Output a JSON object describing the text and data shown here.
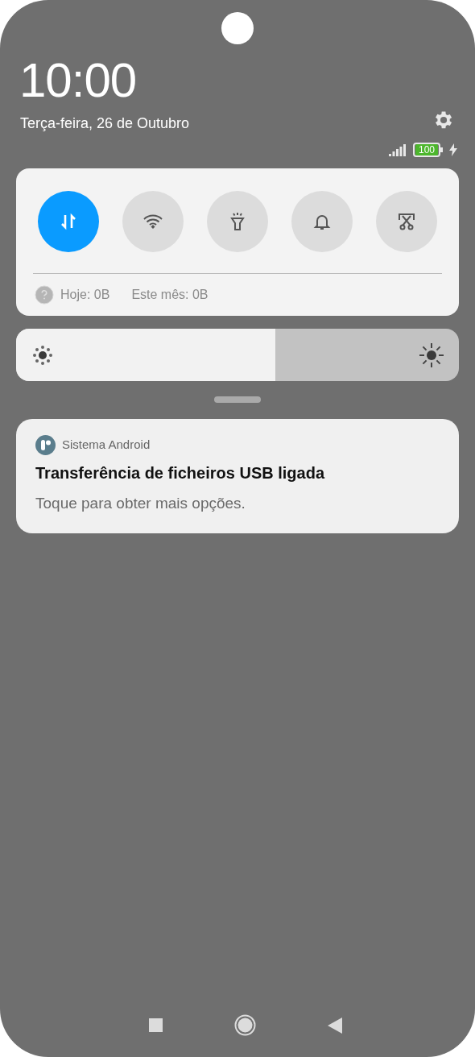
{
  "header": {
    "time": "10:00",
    "date": "Terça-feira, 26 de Outubro",
    "battery": "100",
    "charging": true
  },
  "toggles": [
    {
      "kind": "data",
      "on": true
    },
    {
      "kind": "wifi",
      "on": false
    },
    {
      "kind": "flashlight",
      "on": false
    },
    {
      "kind": "bell",
      "on": false
    },
    {
      "kind": "screenshot",
      "on": false
    }
  ],
  "data_usage": {
    "today": "Hoje: 0B",
    "month": "Este mês: 0B"
  },
  "brightness": {
    "level": 0.585
  },
  "notification": {
    "app": "Sistema Android",
    "title": "Transferência de ficheiros USB ligada",
    "text": "Toque para obter mais opções."
  }
}
